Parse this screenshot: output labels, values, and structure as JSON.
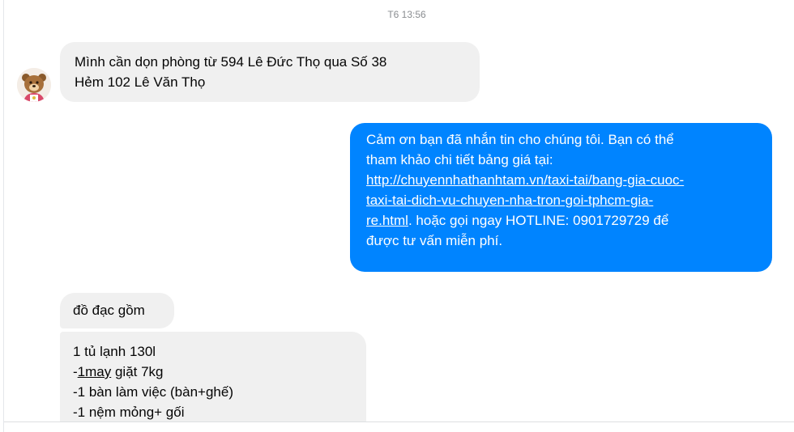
{
  "conversation": {
    "timestamp": "T6 13:56",
    "messages": [
      {
        "lines": [
          "Mình cần dọn phòng từ 594 Lê Đức Thọ qua Số 38",
          "Hẻm 102 Lê Văn Thọ"
        ]
      },
      {
        "line1": "Cảm ơn bạn đã nhắn tin cho chúng tôi. Bạn có thể",
        "line2": "tham khảo chi tiết bảng giá tại:",
        "link_line1": "http://chuyennhathanhtam.vn/taxi-tai/bang-gia-cuoc-",
        "link_line2": "taxi-tai-dich-vu-chuyen-nha-tron-goi-tphcm-gia-",
        "link_line3": "re.html",
        "line5_rest": ". hoặc gọi ngay HOTLINE: 0901729729 để",
        "line6": "được tư vấn miễn phí."
      },
      {
        "text": "đồ đạc gồm"
      },
      {
        "line1": "1 tủ lạnh 130l",
        "line2_prefix": "-",
        "line2_underlined": "1may",
        "line2_rest": " giặt 7kg",
        "line3": "-1 bàn làm việc (bàn+ghế)",
        "line4": "-1 nệm mỏng+ gối"
      }
    ]
  },
  "colors": {
    "outgoing_bubble": "#0084ff",
    "incoming_bubble": "#f0f0f0"
  }
}
